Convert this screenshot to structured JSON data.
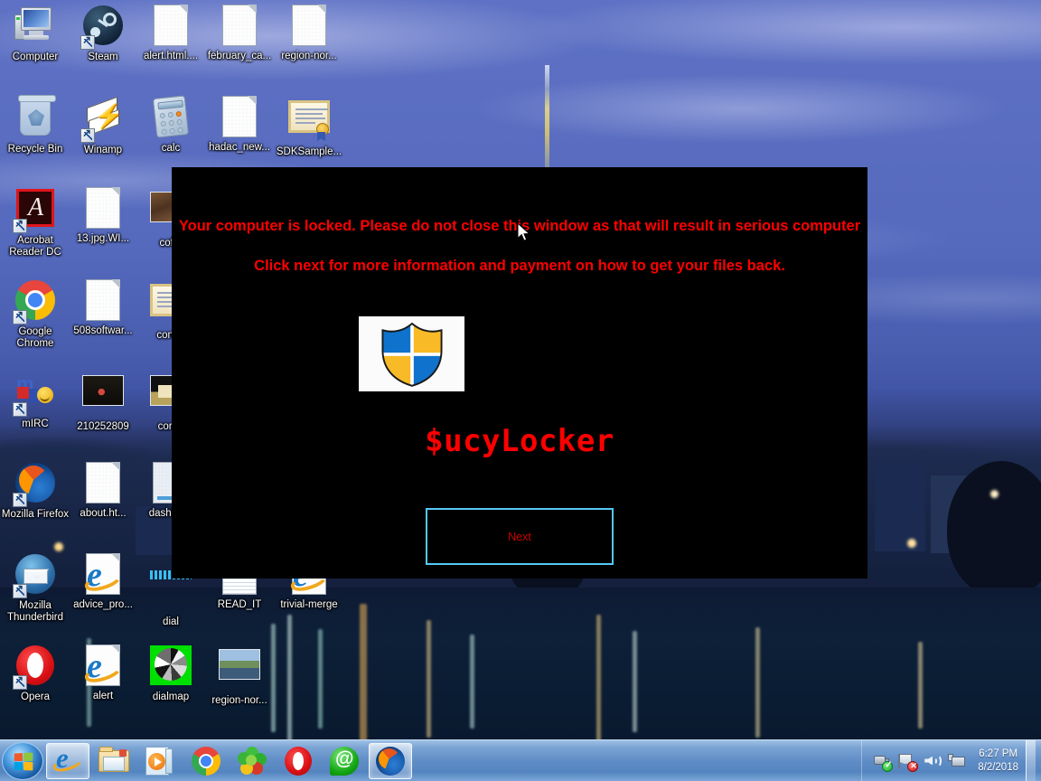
{
  "wallpaper": {
    "description": "night cityscape over water with blue sky",
    "sky_color": "#5a6dc0",
    "water_color": "#0d2038"
  },
  "desktop": {
    "icons": [
      {
        "label": "Computer",
        "type": "computer",
        "shortcut": false,
        "col": 0,
        "row": 0
      },
      {
        "label": "Steam",
        "type": "steam",
        "shortcut": true,
        "col": 1,
        "row": 0
      },
      {
        "label": "alert.html....",
        "type": "doc",
        "shortcut": false,
        "col": 2,
        "row": 0
      },
      {
        "label": "february_ca...",
        "type": "doc",
        "shortcut": false,
        "col": 3,
        "row": 0
      },
      {
        "label": "region-nor...",
        "type": "doc",
        "shortcut": false,
        "col": 4,
        "row": 0
      },
      {
        "label": "Recycle Bin",
        "type": "bin",
        "shortcut": false,
        "col": 0,
        "row": 1
      },
      {
        "label": "Winamp",
        "type": "winamp",
        "shortcut": true,
        "col": 1,
        "row": 1
      },
      {
        "label": "calc",
        "type": "calc",
        "shortcut": false,
        "col": 2,
        "row": 1
      },
      {
        "label": "hadac_new...",
        "type": "doc",
        "shortcut": false,
        "col": 3,
        "row": 1
      },
      {
        "label": "SDKSample...",
        "type": "cert",
        "shortcut": false,
        "col": 4,
        "row": 1
      },
      {
        "label": "Acrobat Reader DC",
        "type": "acrobat",
        "shortcut": true,
        "col": 0,
        "row": 2
      },
      {
        "label": "13.jpg.WI...",
        "type": "doc",
        "shortcut": false,
        "col": 1,
        "row": 2
      },
      {
        "label": "cof...",
        "type": "photo1",
        "shortcut": false,
        "col": 2,
        "row": 2
      },
      {
        "label": "Google Chrome",
        "type": "chrome",
        "shortcut": true,
        "col": 0,
        "row": 3
      },
      {
        "label": "508softwar...",
        "type": "doc",
        "shortcut": false,
        "col": 1,
        "row": 3
      },
      {
        "label": "cont...",
        "type": "cert",
        "shortcut": false,
        "col": 2,
        "row": 3
      },
      {
        "label": "mIRC",
        "type": "mirc",
        "shortcut": true,
        "col": 0,
        "row": 4
      },
      {
        "label": "210252809",
        "type": "photo2",
        "shortcut": false,
        "col": 1,
        "row": 4
      },
      {
        "label": "corr...",
        "type": "photo4",
        "shortcut": false,
        "col": 2,
        "row": 4
      },
      {
        "label": "Mozilla Firefox",
        "type": "firefox",
        "shortcut": true,
        "col": 0,
        "row": 5
      },
      {
        "label": "about.ht...",
        "type": "doc",
        "shortcut": false,
        "col": 1,
        "row": 5
      },
      {
        "label": "dashBo...",
        "type": "dash",
        "shortcut": false,
        "col": 2,
        "row": 5
      },
      {
        "label": "Mozilla Thunderbird",
        "type": "thunderbird",
        "shortcut": true,
        "col": 0,
        "row": 6
      },
      {
        "label": "advice_pro...",
        "type": "iedoc",
        "shortcut": false,
        "col": 1,
        "row": 6
      },
      {
        "label": "dial",
        "type": "dial",
        "shortcut": false,
        "col": 2,
        "row": 6
      },
      {
        "label": "READ_IT",
        "type": "lined",
        "shortcut": false,
        "col": 3,
        "row": 6
      },
      {
        "label": "trivial-merge",
        "type": "iedoc",
        "shortcut": false,
        "col": 4,
        "row": 6
      },
      {
        "label": "Opera",
        "type": "opera",
        "shortcut": true,
        "col": 0,
        "row": 7
      },
      {
        "label": "alert",
        "type": "iedoc",
        "shortcut": false,
        "col": 1,
        "row": 7
      },
      {
        "label": "dialmap",
        "type": "dialmap",
        "shortcut": false,
        "col": 2,
        "row": 7
      },
      {
        "label": "region-nor...",
        "type": "photo3",
        "shortcut": false,
        "col": 3,
        "row": 7
      }
    ]
  },
  "ransom_window": {
    "line1": "Your computer is locked. Please do not close this window as that will result in serious computer",
    "line2": "Click next for more information and payment on how to get your files back.",
    "brand": "$ucyLocker",
    "next_label": "Next",
    "text_color": "#ff0000",
    "background_color": "#000000",
    "button_border_color": "#55c8f5",
    "button_text_color": "#cc0000",
    "shield": {
      "name": "windows-defender-shield-icon",
      "blue": "#0f72cc",
      "yellow": "#f9ba27",
      "outline": "#1a1a1a",
      "plate_background": "#fbfbfb"
    }
  },
  "taskbar": {
    "start_label": "Start",
    "items": [
      {
        "name": "internet-explorer",
        "label": "Internet Explorer",
        "active": true
      },
      {
        "name": "file-explorer",
        "label": "Windows Explorer",
        "active": false
      },
      {
        "name": "windows-media-player",
        "label": "Windows Media Player",
        "active": false
      },
      {
        "name": "google-chrome",
        "label": "Google Chrome",
        "active": false
      },
      {
        "name": "icq",
        "label": "ICQ",
        "active": false
      },
      {
        "name": "opera",
        "label": "Opera",
        "active": false
      },
      {
        "name": "mail-at",
        "label": "Mail.ru Agent",
        "active": false
      },
      {
        "name": "mozilla-firefox",
        "label": "Mozilla Firefox",
        "active": true
      }
    ],
    "tray": [
      {
        "name": "usb-safely-remove-icon",
        "label": "Safely Remove Hardware"
      },
      {
        "name": "action-center-flag-icon",
        "label": "Action Center"
      },
      {
        "name": "volume-speaker-icon",
        "label": "Volume"
      },
      {
        "name": "network-icon",
        "label": "Network"
      }
    ],
    "clock": {
      "time": "6:27 PM",
      "date": "8/2/2018"
    }
  }
}
